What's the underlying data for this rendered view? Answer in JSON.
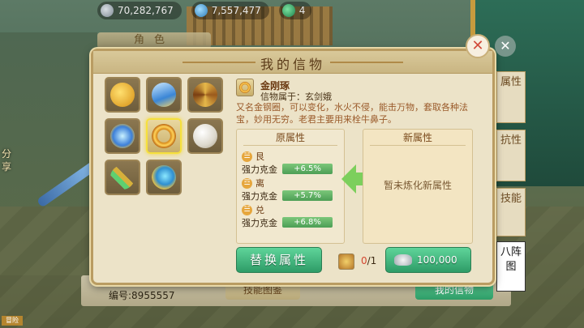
{
  "topbar": {
    "coins": "70,282,767",
    "gems": "7,557,477",
    "jade": "4"
  },
  "background": {
    "role_tab": "角色",
    "side_left": [
      "分",
      "享"
    ],
    "bottom_badge": "冒险"
  },
  "panel": {
    "title": "我的信物",
    "items": [
      {
        "icon": "gourd-icon"
      },
      {
        "icon": "vase-icon"
      },
      {
        "icon": "staff-icon"
      },
      {
        "icon": "orb-icon"
      },
      {
        "icon": "ring-icon",
        "selected": true
      },
      {
        "icon": "pearl-icon"
      },
      {
        "icon": "sickle-icon"
      },
      {
        "icon": "feather-icon"
      }
    ],
    "detail": {
      "name": "金刚琢",
      "owner": "信物属于：玄剑娥",
      "description": "又名金钢圈，可以变化，水火不侵，能击万物，套取各种法宝，妙用无穷。老君主要用来栓牛鼻子。"
    },
    "original": {
      "header": "原属性",
      "attrs": [
        {
          "trigram": "☱",
          "name": "艮",
          "stat": "强力克金",
          "value": "+6.5%"
        },
        {
          "trigram": "☲",
          "name": "离",
          "stat": "强力克金",
          "value": "+5.7%"
        },
        {
          "trigram": "☱",
          "name": "兑",
          "stat": "强力克金",
          "value": "+6.8%"
        }
      ]
    },
    "new": {
      "header": "新属性",
      "empty_text": "暂未炼化新属性"
    },
    "replace_button": "替换属性",
    "material": {
      "owned": "0",
      "needed": "/1"
    },
    "cost": "100,000"
  },
  "right_tabs": [
    "属性",
    "抗性",
    "技能",
    "八阵图"
  ],
  "bottom": {
    "serial": "编号:8955557",
    "tech_button": "技能图鉴",
    "mine_button": "我的信物"
  },
  "colors": {
    "accent_green": "#2e9c67",
    "panel_bg": "#ece3c8",
    "title_brown": "#5a3a18",
    "desc_orange": "#9a5a2a"
  }
}
